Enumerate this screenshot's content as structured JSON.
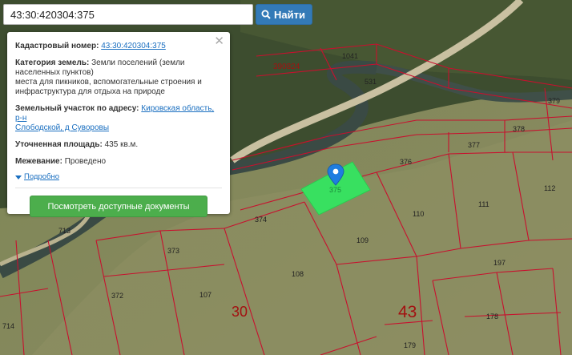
{
  "search": {
    "value": "43:30:420304:375",
    "button_label": "Найти",
    "button_icon": "search-icon"
  },
  "info_panel": {
    "cadastral_label": "Кадастровый номер:",
    "cadastral_value": "43:30:420304:375",
    "category_label": "Категория земель:",
    "category_value_line1": "Земли поселений (земли",
    "category_value_line2": "населенных пунктов)",
    "category_value_line3": "места для пикников, вспомогательные строения и",
    "category_value_line4": "инфраструктура для отдыха на природе",
    "address_label": "Земельный участок по адресу:",
    "address_value_part1": "Кировская область, р-н",
    "address_value_part2": "Слободской, д Суворовы",
    "area_label": "Уточненная площадь:",
    "area_value": "435 кв.м.",
    "survey_label": "Межевание:",
    "survey_value": "Проведено",
    "details_label": "Подробно",
    "docs_button": "Посмотреть доступные документы",
    "close_icon": "close-icon"
  },
  "map": {
    "selected_plot_color": "#38e060",
    "boundary_color": "#c8102e",
    "marker_color": "#1f7de0",
    "selected_label": "375",
    "parcel_labels": [
      "1041",
      "390824",
      "531",
      "379",
      "378",
      "377",
      "376",
      "112",
      "111",
      "110",
      "109",
      "374",
      "713",
      "373",
      "108",
      "107",
      "372",
      "197",
      "178",
      "179",
      "714"
    ],
    "quarter_labels": [
      "30",
      "43"
    ]
  }
}
